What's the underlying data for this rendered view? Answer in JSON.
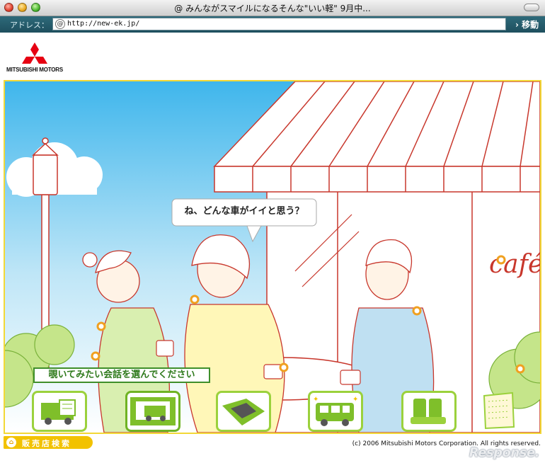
{
  "window": {
    "title": "@ みんながスマイルになるそんな\"いい軽\" 9月中..."
  },
  "address_bar": {
    "label": "アドレス：",
    "url": "http://new-ek.jp/",
    "go_label": "移動"
  },
  "logo": {
    "text": "MITSUBISHI MOTORS",
    "color": "#e60012"
  },
  "scene": {
    "speech": "ね、どんな車がイイと思う？",
    "choose_prompt": "覗いてみたい会話を選んでください",
    "cafe_sign": "café"
  },
  "nav_buttons": [
    {
      "icon": "cargo-van-icon"
    },
    {
      "icon": "van-interior-icon"
    },
    {
      "icon": "floor-space-icon"
    },
    {
      "icon": "sparkle-car-icon"
    },
    {
      "icon": "seat-icon"
    },
    {
      "icon": "notepad-icon"
    }
  ],
  "footer": {
    "dealer_button": "販売店検索",
    "copyright": "(c) 2006 Mitsubishi Motors Corporation. All rights reserved.",
    "watermark": "Response."
  },
  "colors": {
    "accent_green": "#9bd13c",
    "frame_yellow": "#f2d836",
    "dealer_yellow": "#f2c200",
    "toolbar_teal": "#1e4f5e"
  }
}
